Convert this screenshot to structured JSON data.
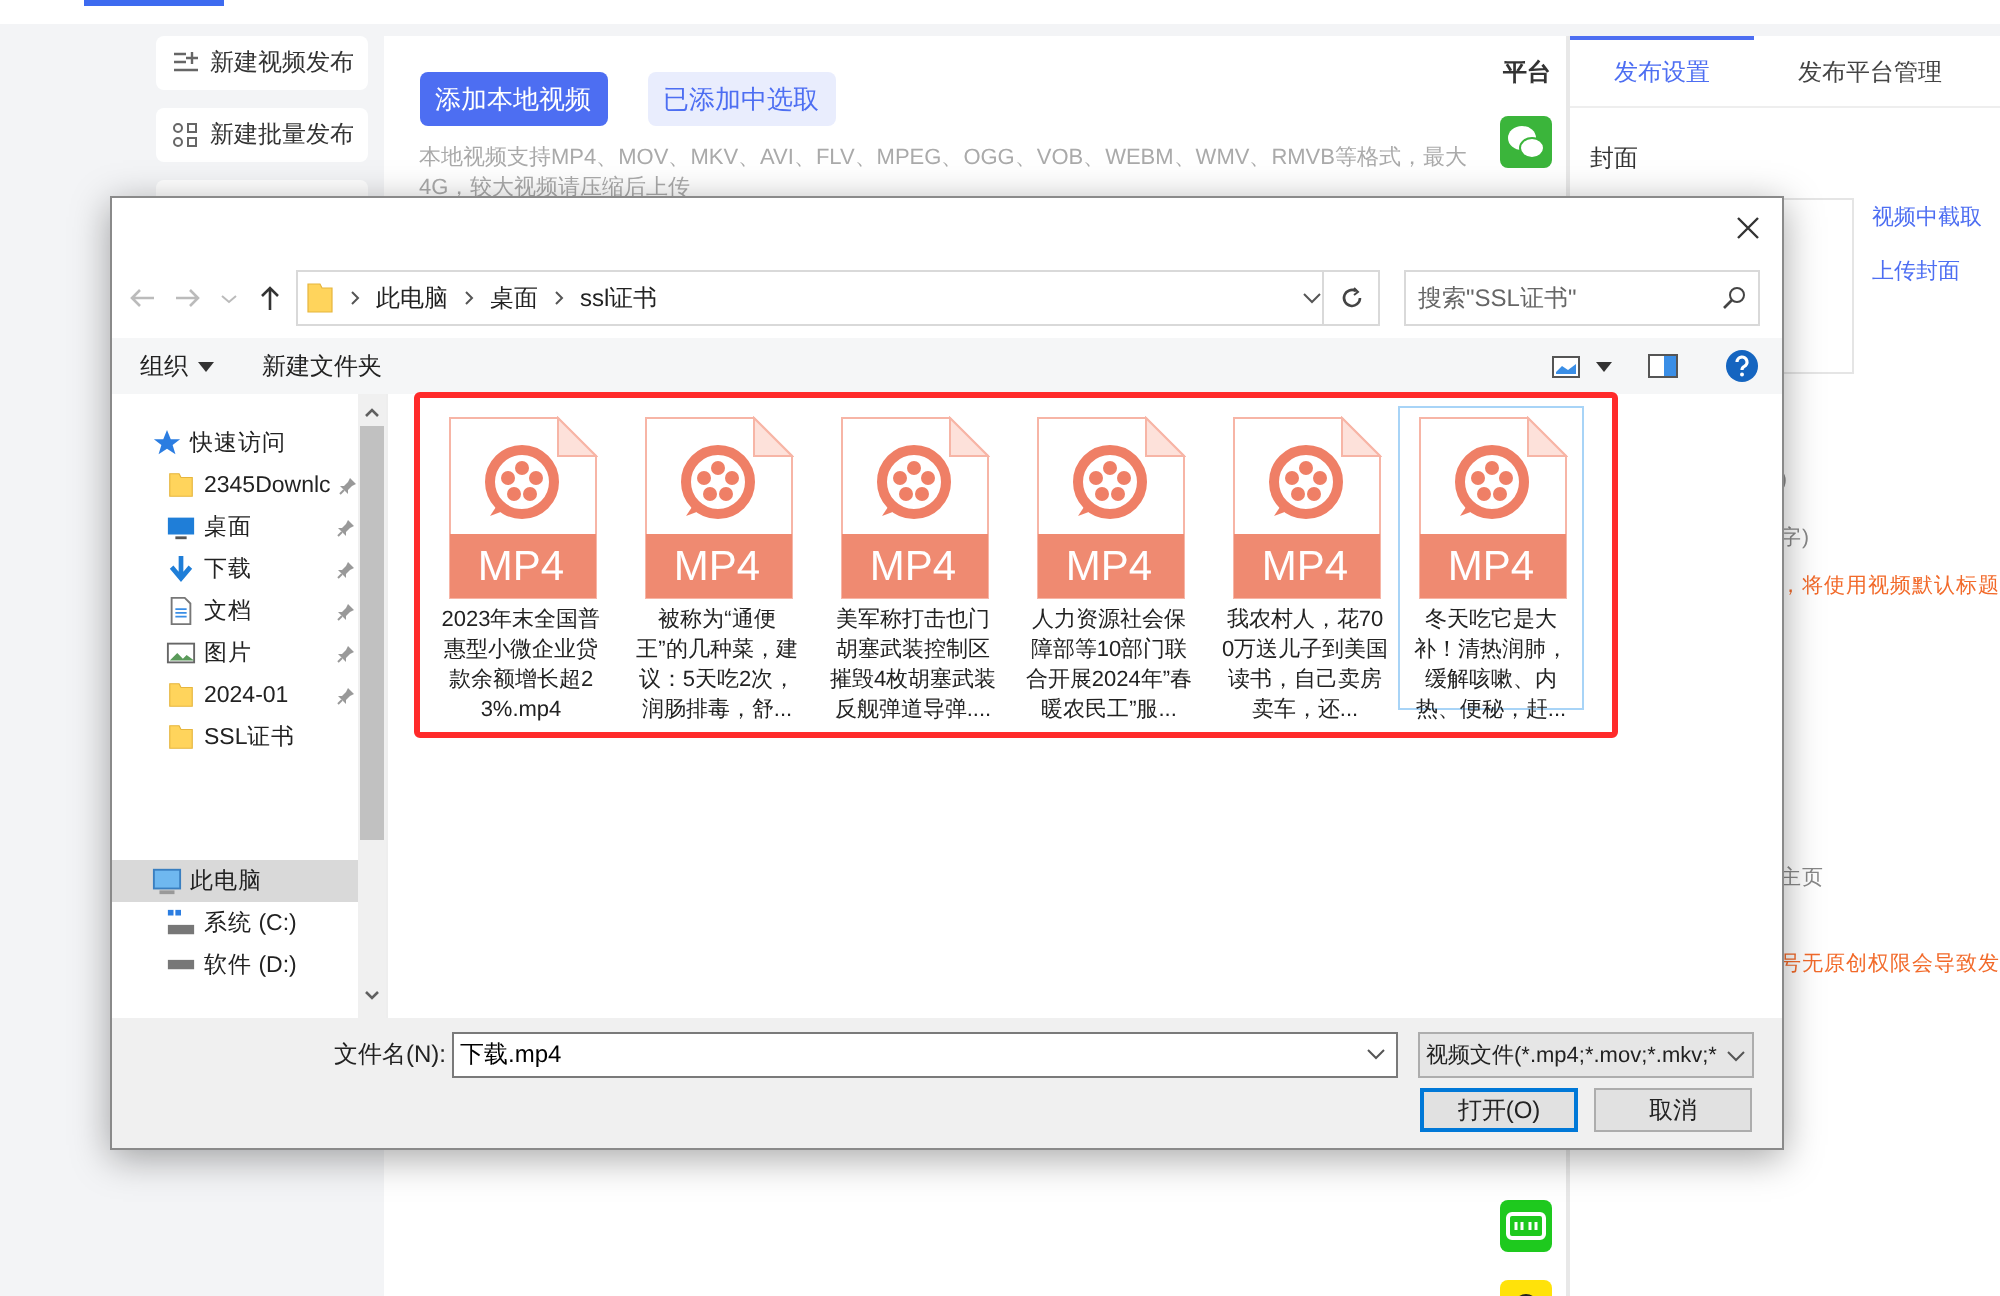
{
  "sidebar": {
    "items": [
      {
        "label": "新建视频发布",
        "kind": "list"
      },
      {
        "label": "新建批量发布",
        "kind": "grid"
      }
    ]
  },
  "upload": {
    "buttons": [
      {
        "label": "添加本地视频",
        "primary": true
      },
      {
        "label": "已添加中选取",
        "primary": false
      }
    ],
    "hint": "本地视频支持MP4、MOV、MKV、AVI、FLV、MPEG、OGG、VOB、WEBM、WMV、RMVB等格式，最大4G，较大视频请压缩后上传"
  },
  "platforms": {
    "header": "平台",
    "items": [
      {
        "kind": "wechat"
      },
      {
        "kind": "iqiyi"
      },
      {
        "kind": "yellow"
      }
    ]
  },
  "settings": {
    "tabs": [
      {
        "label": "发布设置",
        "selected": true
      },
      {
        "label": "发布平台管理",
        "selected": false
      }
    ],
    "cover_label": "封面",
    "cover_links": [
      "视频中截取",
      "上传封面"
    ],
    "partial_texts": [
      {
        "text": ")",
        "kind": "note"
      },
      {
        "text": "字)",
        "kind": "note"
      },
      {
        "text": "，将使用视频默认标题",
        "kind": "warning"
      },
      {
        "text": "主页",
        "kind": "note"
      },
      {
        "text": "号无原创权限会导致发",
        "kind": "warning"
      }
    ]
  },
  "dialog": {
    "path": [
      "此电脑",
      "桌面",
      "ssl证书"
    ],
    "search_placeholder": "搜索\"SSL证书\"",
    "toolbar": [
      {
        "label": "组织",
        "menu": true
      },
      {
        "label": "新建文件夹",
        "menu": false
      }
    ],
    "nav": [
      {
        "label": "快速访问",
        "kind": "star",
        "pinned": false,
        "selected": false,
        "children": [
          {
            "label": "2345Downlc",
            "kind": "folder",
            "pinned": true,
            "selected": false
          },
          {
            "label": "桌面",
            "kind": "desktop",
            "pinned": true,
            "selected": false
          },
          {
            "label": "下载",
            "kind": "download",
            "pinned": true,
            "selected": false
          },
          {
            "label": "文档",
            "kind": "document",
            "pinned": true,
            "selected": false
          },
          {
            "label": "图片",
            "kind": "picture",
            "pinned": true,
            "selected": false
          },
          {
            "label": "2024-01",
            "kind": "folder",
            "pinned": true,
            "selected": false
          },
          {
            "label": "SSL证书",
            "kind": "folder",
            "pinned": false,
            "selected": false
          }
        ]
      },
      {
        "label": "此电脑",
        "kind": "computer",
        "pinned": false,
        "selected": true,
        "children": [
          {
            "label": "系统 (C:)",
            "kind": "system-drive",
            "pinned": false,
            "selected": false
          },
          {
            "label": "软件 (D:)",
            "kind": "drive",
            "pinned": false,
            "selected": false
          }
        ]
      }
    ],
    "files": [
      {
        "name": "2023年末全国普惠型小微企业贷款余额增长超23%.mp4",
        "badge": "MP4",
        "selected": false
      },
      {
        "name": "被称为“通便王”的几种菜，建议：5天吃2次，润肠排毒，舒...",
        "badge": "MP4",
        "selected": false
      },
      {
        "name": "美军称打击也门胡塞武装控制区摧毁4枚胡塞武装反舰弹道导弹....",
        "badge": "MP4",
        "selected": false
      },
      {
        "name": "人力资源社会保障部等10部门联合开展2024年”春暖农民工”服...",
        "badge": "MP4",
        "selected": false
      },
      {
        "name": "我农村人，花700万送儿子到美国读书，自己卖房卖车，还...",
        "badge": "MP4",
        "selected": false
      },
      {
        "name": "冬天吃它是大补！清热润肺，缓解咳嗽、内热、便秘，赶...",
        "badge": "MP4",
        "selected": true
      }
    ],
    "file_name_label": "文件名(N):",
    "file_name": "下载.mp4",
    "file_type": "视频文件(*.mp4;*.mov;*.mkv;*",
    "buttons": [
      {
        "label": "打开(O)",
        "default": true
      },
      {
        "label": "取消",
        "default": false
      }
    ]
  }
}
